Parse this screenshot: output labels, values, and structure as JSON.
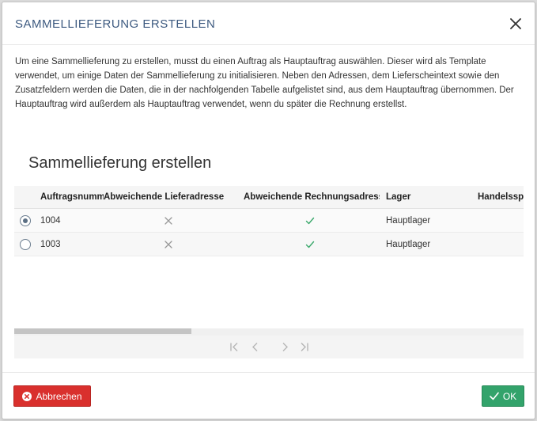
{
  "dialog": {
    "title": "SAMMELLIEFERUNG ERSTELLEN",
    "intro": "Um eine Sammellieferung zu erstellen, musst du einen Auftrag als Hauptauftrag auswählen. Dieser wird als Template verwendet, um einige Daten der Sammellieferung zu initialisieren. Neben den Adressen, dem Lieferscheintext sowie den Zusatzfeldern werden die Daten, die in der nachfolgenden Tabelle aufgelistet sind, aus dem Hauptauftrag übernommen. Der Hauptauftrag wird außerdem als Hauptauftrag verwendet, wenn du später die Rechnung erstellst.",
    "section_title": "Sammellieferung erstellen"
  },
  "table": {
    "columns": [
      "Auftragsnummer",
      "Abweichende Lieferadresse",
      "Abweichende Rechnungsadresse",
      "Lager",
      "Handelsspanne"
    ],
    "rows": [
      {
        "selected": true,
        "order_no": "1004",
        "alt_delivery": "cross-icon",
        "alt_billing": "check-icon",
        "warehouse": "Hauptlager",
        "margin": ""
      },
      {
        "selected": false,
        "order_no": "1003",
        "alt_delivery": "cross-icon",
        "alt_billing": "check-icon",
        "warehouse": "Hauptlager",
        "margin": ""
      }
    ]
  },
  "footer": {
    "cancel_label": "Abbrechen",
    "ok_label": "OK"
  },
  "colors": {
    "title": "#3d5a80",
    "cancel": "#d9302d",
    "ok": "#33a36b",
    "check": "#3aa86b",
    "cross": "#999999"
  }
}
